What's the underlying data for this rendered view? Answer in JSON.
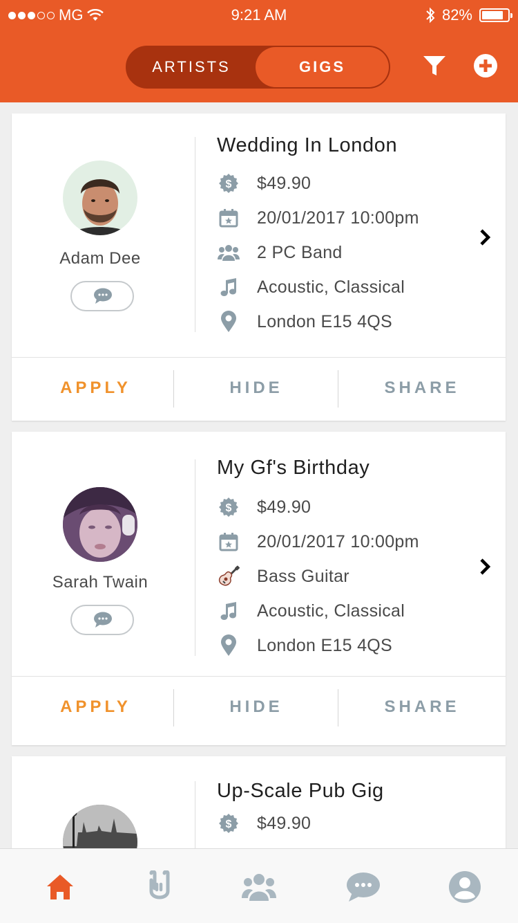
{
  "status_bar": {
    "carrier": "MG",
    "time": "9:21 AM",
    "battery": "82%",
    "battery_level": 0.82
  },
  "header": {
    "segments": [
      {
        "label": "ARTISTS",
        "active": false
      },
      {
        "label": "GIGS",
        "active": true
      }
    ],
    "icons": [
      "filter-icon",
      "add-circle-icon"
    ],
    "colors": {
      "brand": "#e95a27",
      "segment_bg": "#a8320f"
    }
  },
  "gigs": [
    {
      "artist": "Adam Dee",
      "title": "Wedding In London",
      "price": "$49.90",
      "date": "20/01/2017 10:00pm",
      "lineup": "2 PC Band",
      "lineup_icon": "group-icon",
      "genre": "Acoustic, Classical",
      "location": "London E15 4QS"
    },
    {
      "artist": "Sarah Twain",
      "title": "My Gf's Birthday",
      "price": "$49.90",
      "date": "20/01/2017 10:00pm",
      "lineup": "Bass Guitar",
      "lineup_icon": "guitar-icon",
      "genre": "Acoustic, Classical",
      "location": "London E15 4QS"
    },
    {
      "title": "Up-Scale Pub Gig",
      "price": "$49.90"
    }
  ],
  "actions": {
    "apply": "APPLY",
    "hide": "HIDE",
    "share": "SHARE",
    "apply_color": "#f0922c",
    "muted_color": "#8c9da7"
  },
  "tabbar": {
    "tabs": [
      "home-icon",
      "rock-hand-icon",
      "group-icon",
      "chat-icon",
      "profile-icon"
    ],
    "active_color": "#e95a27",
    "inactive_color": "#a9b7c0"
  }
}
